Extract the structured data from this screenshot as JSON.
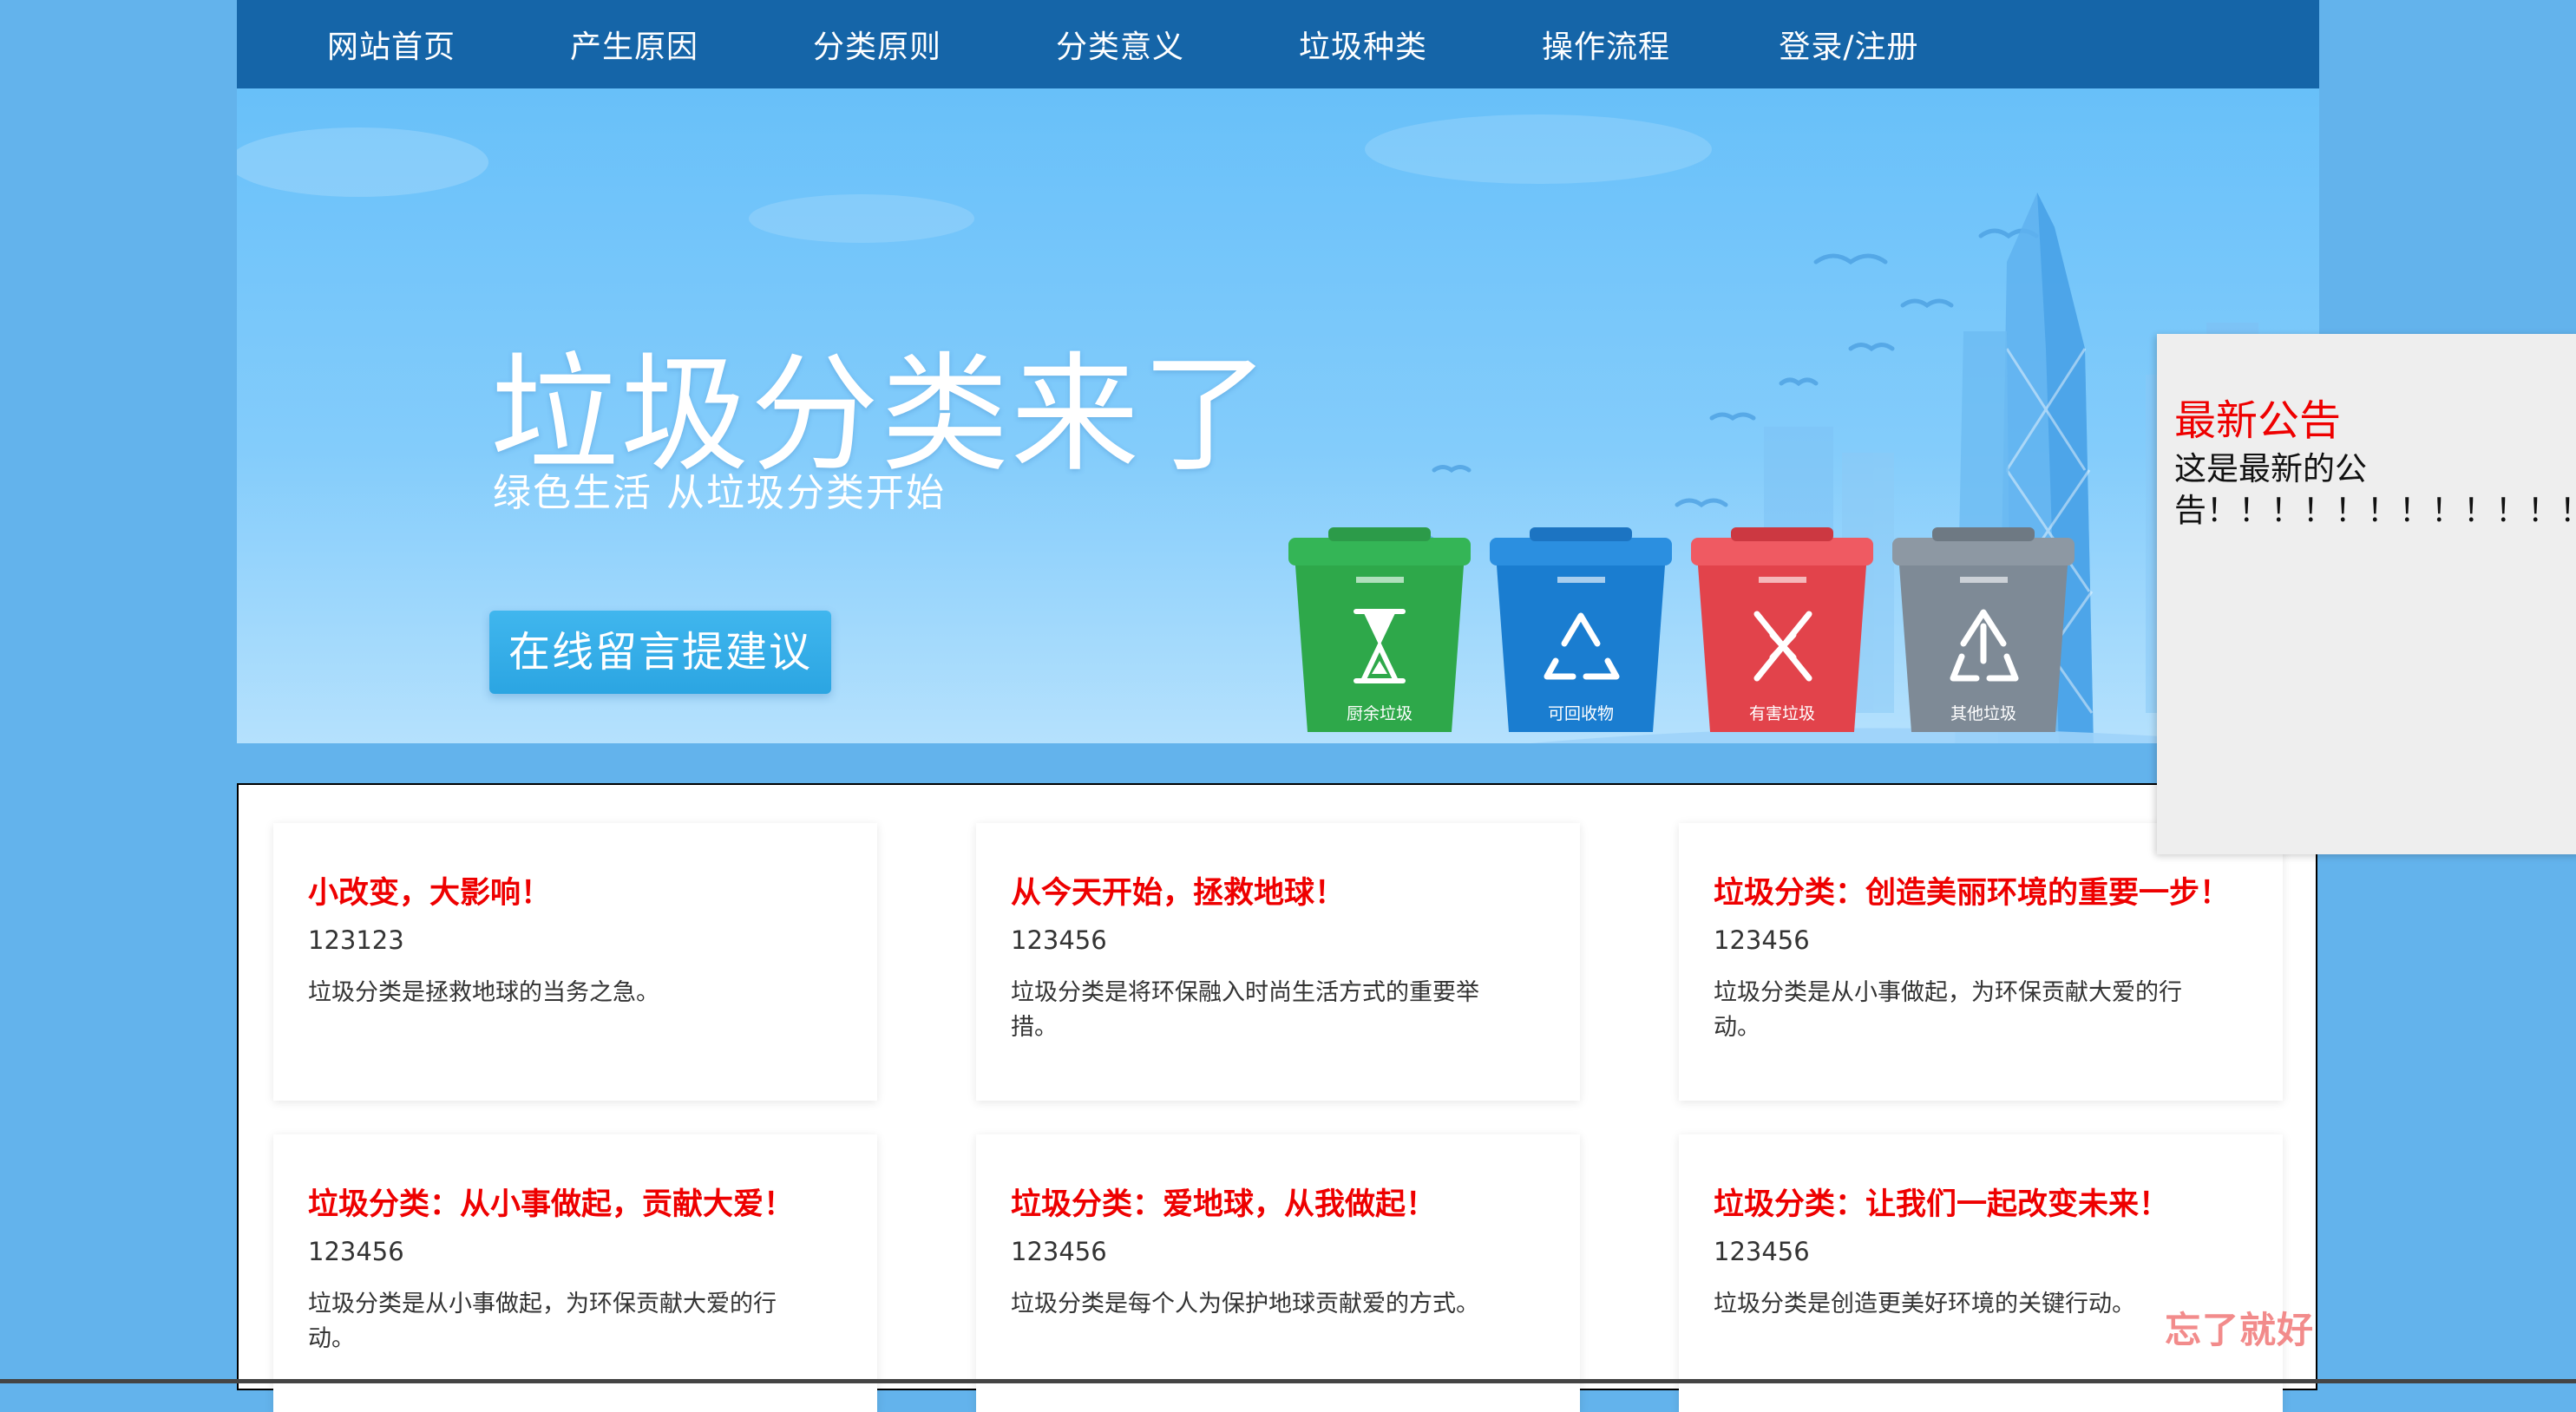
{
  "nav": {
    "items": [
      {
        "label": "网站首页"
      },
      {
        "label": "产生原因"
      },
      {
        "label": "分类原则"
      },
      {
        "label": "分类意义"
      },
      {
        "label": "垃圾种类"
      },
      {
        "label": "操作流程"
      },
      {
        "label": "登录/注册"
      }
    ]
  },
  "banner": {
    "title": "垃圾分类来了",
    "subtitle": "绿色生活 从垃圾分类开始",
    "button_label": "在线留言提建议",
    "bins": [
      {
        "label": "厨余垃圾",
        "color": "#2ea84a",
        "icon": "hourglass-icon"
      },
      {
        "label": "可回收物",
        "color": "#1a7dd0",
        "icon": "recycle-icon"
      },
      {
        "label": "有害垃圾",
        "color": "#e2434b",
        "icon": "hazard-icon"
      },
      {
        "label": "其他垃圾",
        "color": "#7e8a96",
        "icon": "other-recycle-icon"
      }
    ]
  },
  "cards": [
    {
      "title": "小改变，大影响！",
      "num": "123123",
      "desc": "垃圾分类是拯救地球的当务之急。"
    },
    {
      "title": "从今天开始，拯救地球！",
      "num": "123456",
      "desc": "垃圾分类是将环保融入时尚生活方式的重要举措。"
    },
    {
      "title": "垃圾分类：创造美丽环境的重要一步！",
      "num": "123456",
      "desc": "垃圾分类是从小事做起，为环保贡献大爱的行动。"
    },
    {
      "title": "垃圾分类：从小事做起，贡献大爱！",
      "num": "123456",
      "desc": "垃圾分类是从小事做起，为环保贡献大爱的行动。"
    },
    {
      "title": "垃圾分类：爱地球，从我做起！",
      "num": "123456",
      "desc": "垃圾分类是每个人为保护地球贡献爱的方式。"
    },
    {
      "title": "垃圾分类：让我们一起改变未来！",
      "num": "123456",
      "desc": "垃圾分类是创造更美好环境的关键行动。"
    }
  ],
  "notice": {
    "title": "最新公告",
    "text": "这是最新的公告！！！！！！！！！！！！"
  },
  "watermark": "忘了就好",
  "colors": {
    "page_bg": "#63b3ec",
    "nav_bg": "#1565a8",
    "card_title": "#ee0000",
    "notice_bg": "#eeeeee"
  }
}
